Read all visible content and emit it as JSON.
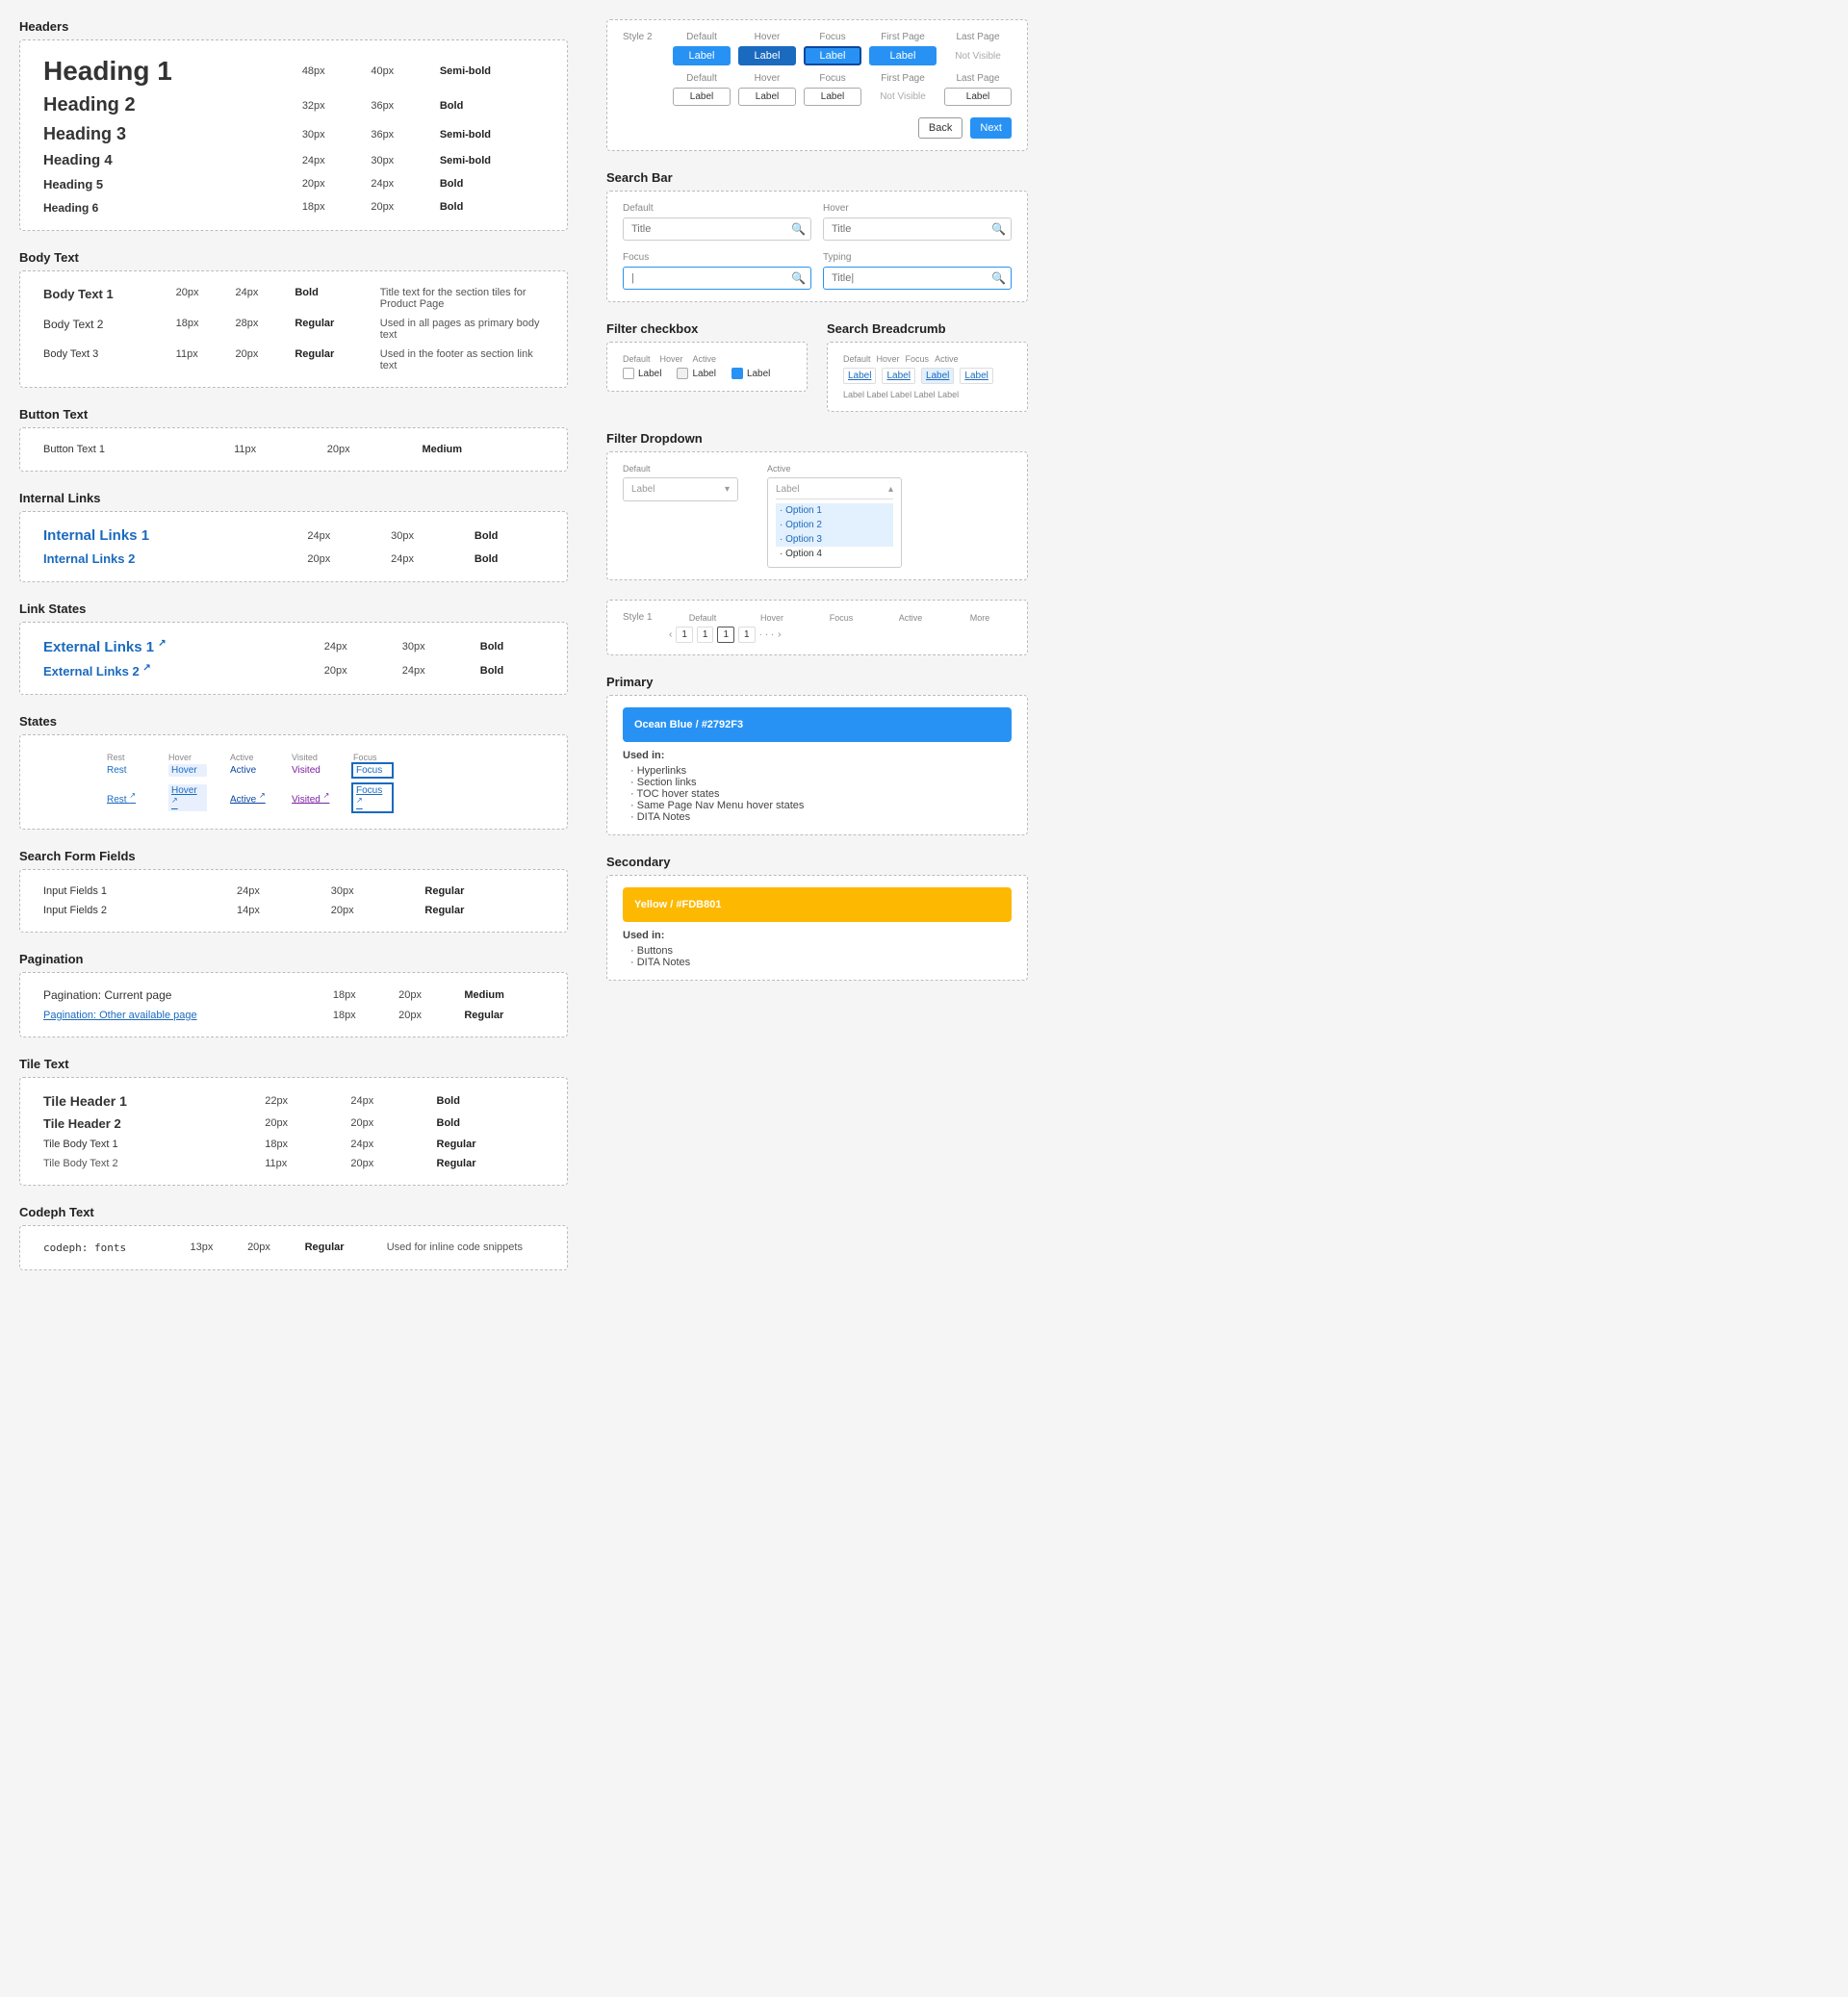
{
  "sections": {
    "headers": {
      "title": "Headers",
      "rows": [
        {
          "label": "Heading 1",
          "size1": "48px",
          "size2": "40px",
          "weight": "Semi-bold",
          "class": "h1"
        },
        {
          "label": "Heading 2",
          "size1": "32px",
          "size2": "36px",
          "weight": "Bold",
          "class": "h2"
        },
        {
          "label": "Heading 3",
          "size1": "30px",
          "size2": "36px",
          "weight": "Semi-bold",
          "class": "h3"
        },
        {
          "label": "Heading 4",
          "size1": "24px",
          "size2": "30px",
          "weight": "Semi-bold",
          "class": "h4"
        },
        {
          "label": "Heading 5",
          "size1": "20px",
          "size2": "24px",
          "weight": "Bold",
          "class": "h5"
        },
        {
          "label": "Heading 6",
          "size1": "18px",
          "size2": "20px",
          "weight": "Bold",
          "class": "h6"
        }
      ]
    },
    "body_text": {
      "title": "Body Text",
      "rows": [
        {
          "label": "Body Text 1",
          "size1": "20px",
          "size2": "24px",
          "weight": "Bold",
          "desc": "Title text for the section tiles for Product Page",
          "class": "bt1"
        },
        {
          "label": "Body Text 2",
          "size1": "18px",
          "size2": "28px",
          "weight": "Regular",
          "desc": "Used in all pages as primary body text",
          "class": "bt2"
        },
        {
          "label": "Body Text 3",
          "size1": "11px",
          "size2": "20px",
          "weight": "Regular",
          "desc": "Used in the footer as section link text",
          "class": "bt3"
        }
      ]
    },
    "button_text": {
      "title": "Button Text",
      "rows": [
        {
          "label": "Button Text 1",
          "size1": "11px",
          "size2": "20px",
          "weight": "Medium",
          "class": "btn-text"
        }
      ]
    },
    "internal_links": {
      "title": "Internal Links",
      "rows": [
        {
          "label": "Internal Links 1",
          "size1": "24px",
          "size2": "30px",
          "weight": "Bold",
          "class": "int-link-1"
        },
        {
          "label": "Internal Links 2",
          "size1": "20px",
          "size2": "24px",
          "weight": "Bold",
          "class": "int-link-2"
        }
      ]
    },
    "link_states": {
      "title": "Link States",
      "rows": [
        {
          "label": "External Links 1",
          "icon": "↗",
          "size1": "24px",
          "size2": "30px",
          "weight": "Bold",
          "class": "ext-link-1"
        },
        {
          "label": "External Links 2",
          "icon": "↗",
          "size1": "20px",
          "size2": "24px",
          "weight": "Bold",
          "class": "ext-link-2"
        }
      ]
    },
    "states": {
      "title": "States",
      "state_labels": [
        "Rest",
        "Hover",
        "Active",
        "Visited",
        "Focus"
      ],
      "row1": {
        "items": [
          "Rest",
          "Hover",
          "Active",
          "Visited",
          "Focus"
        ],
        "types": [
          "rest",
          "hover",
          "active",
          "visited",
          "focus"
        ]
      },
      "row2": {
        "items": [
          "Rest ↗",
          "Hover ↗",
          "Active ↗",
          "Visited ↗",
          "Focus ↗"
        ],
        "types": [
          "rest",
          "hover",
          "active",
          "visited",
          "focus"
        ]
      }
    },
    "search_form": {
      "title": "Search Form Fields",
      "rows": [
        {
          "label": "Input Fields 1",
          "size1": "24px",
          "size2": "30px",
          "weight": "Regular"
        },
        {
          "label": "Input Fields 2",
          "size1": "14px",
          "size2": "20px",
          "weight": "Regular"
        }
      ]
    },
    "pagination": {
      "title": "Pagination",
      "rows": [
        {
          "label": "Pagination: Current page",
          "size1": "18px",
          "size2": "20px",
          "weight": "Medium",
          "class": "pag-current"
        },
        {
          "label": "Pagination: Other available page",
          "size1": "18px",
          "size2": "20px",
          "weight": "Regular",
          "class": "pag-other"
        }
      ]
    },
    "tile_text": {
      "title": "Tile Text",
      "rows": [
        {
          "label": "Tile Header 1",
          "size1": "22px",
          "size2": "24px",
          "weight": "Bold",
          "class": "tile-h1"
        },
        {
          "label": "Tile Header 2",
          "size1": "20px",
          "size2": "20px",
          "weight": "Bold",
          "class": "tile-h2"
        },
        {
          "label": "Tile Body Text 1",
          "size1": "18px",
          "size2": "24px",
          "weight": "Regular",
          "class": "tile-b1"
        },
        {
          "label": "Tile Body Text 2",
          "size1": "11px",
          "size2": "20px",
          "weight": "Regular",
          "class": "tile-b2"
        }
      ]
    },
    "codeph": {
      "title": "Codeph Text",
      "rows": [
        {
          "label": "codeph: fonts",
          "size1": "13px",
          "size2": "20px",
          "weight": "Regular",
          "desc": "Used for inline code snippets",
          "class": "codeph-text"
        }
      ]
    }
  },
  "right_panel": {
    "buttons_section": {
      "style2_label": "Style 2",
      "state_headers": [
        "Default",
        "Hover",
        "Focus",
        "First Page",
        "Last Page"
      ],
      "style2_buttons": [
        "Label",
        "Label",
        "Label",
        "Label",
        "Not Visible"
      ],
      "row2_state_headers": [
        "Default",
        "Hover",
        "Focus",
        "First Page",
        "Last Page"
      ],
      "row2_buttons": [
        "Label",
        "Label",
        "Label",
        "Not Visible",
        "Label"
      ],
      "back_label": "Back",
      "next_label": "Next"
    },
    "search_bar": {
      "title": "Search Bar",
      "states": [
        {
          "label": "Default",
          "placeholder": "Title",
          "icon": "🔍"
        },
        {
          "label": "Hover",
          "placeholder": "Title",
          "icon": "🔍"
        },
        {
          "label": "Focus",
          "placeholder": "|",
          "icon": "🔍"
        },
        {
          "label": "Typing",
          "placeholder": "Title|",
          "icon": "🔍"
        }
      ]
    },
    "filter_checkbox": {
      "title": "Filter checkbox",
      "states": [
        {
          "label": "Default",
          "text": "Label"
        },
        {
          "label": "Hover",
          "text": "Label"
        },
        {
          "label": "Active",
          "text": "Label",
          "checked": true
        }
      ]
    },
    "search_breadcrumb": {
      "title": "Search Breadcrumb",
      "state_labels": [
        "Default",
        "Hover",
        "Focus",
        "Active"
      ],
      "items": [
        "Label",
        "Label",
        "Label",
        "Label",
        "Label Label Label Label Label"
      ]
    },
    "filter_dropdown": {
      "title": "Filter Dropdown",
      "state_labels": [
        "Default",
        "Active"
      ],
      "default_label": "Label",
      "options": [
        "Option 1",
        "Option 2",
        "Option 3",
        "Option 4"
      ]
    },
    "pagination_right": {
      "style1_label": "Style 1",
      "state_headers": [
        "Default",
        "Hover",
        "Focus",
        "Active",
        "More"
      ],
      "numbers": [
        "1",
        "1",
        "1",
        "1",
        "·",
        "·",
        "·"
      ]
    },
    "primary_color": {
      "title": "Primary",
      "swatch_label": "Ocean Blue / #2792F3",
      "color": "#2792F3",
      "used_in_title": "Used in:",
      "used_in": [
        "Hyperlinks",
        "Section links",
        "TOC hover states",
        "Same Page Nav Menu hover states",
        "DITA Notes"
      ]
    },
    "secondary_color": {
      "title": "Secondary",
      "swatch_label": "Yellow / #FDB801",
      "color": "#FDB801",
      "used_in_title": "Used in:",
      "used_in": [
        "Buttons",
        "DITA Notes"
      ]
    }
  }
}
